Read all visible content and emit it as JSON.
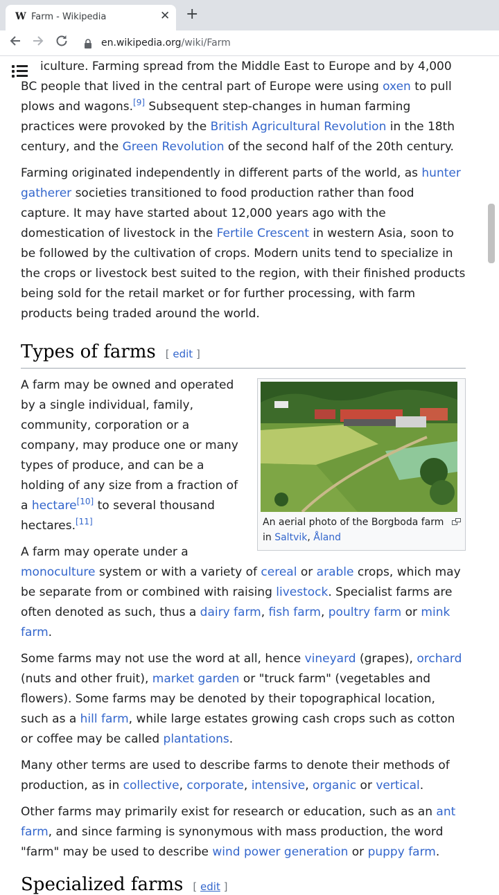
{
  "browser": {
    "tab_logo": "W",
    "tab_title": "Farm - Wikipedia",
    "tab_close": "✕",
    "new_tab": "+",
    "url_host": "en.wikipedia.org",
    "url_path": "/wiki/Farm"
  },
  "intro": {
    "p1": {
      "t1": "iculture. Farming spread from the Middle East to Europe and by 4,000 BC people that lived in the central part of Europe were using ",
      "l1": "oxen",
      "t2": " to pull plows and wagons.",
      "ref1": "[9]",
      "t3": " Subsequent step-changes in human farming practices were provoked by the ",
      "l2": "British Agricultural Revolution",
      "t4": " in the 18th century, and the ",
      "l3": "Green Revolution",
      "t5": " of the second half of the 20th century."
    },
    "p2": {
      "t1": "Farming originated independently in different parts of the world, as ",
      "l1": "hunter gatherer",
      "t2": " societies transitioned to food production rather than food capture. It may have started about 12,000 years ago with the domestication of livestock in the ",
      "l2": "Fertile Crescent",
      "t3": " in western Asia, soon to be followed by the cultivation of crops. Modern units tend to specialize in the crops or livestock best suited to the region, with their finished products being sold for the retail market or for further processing, with farm products being traded around the world."
    }
  },
  "section_types": {
    "heading": "Types of farms",
    "edit_open": "[ ",
    "edit_label": "edit",
    "edit_close": " ]",
    "figure": {
      "caption_text": "An aerial photo of the Borgboda farm in ",
      "caption_link1": "Saltvik",
      "caption_sep": ", ",
      "caption_link2": "Åland"
    },
    "p1": {
      "t1": "A farm may be owned and operated by a single individual, family, community, corporation or a company, may produce one or many types of produce, and can be a holding of any size from a fraction of a ",
      "l1": "hectare",
      "ref1": "[10]",
      "t2": " to several thousand hectares.",
      "ref2": "[11]"
    },
    "p2": {
      "t1": "A farm may operate under a ",
      "l1": "monoculture",
      "t2": " system or with a variety of ",
      "l2": "cereal",
      "t3": " or ",
      "l3": "arable",
      "t4": " crops, which may be separate from or combined with raising ",
      "l4": "livestock",
      "t5": ". Specialist farms are often denoted as such, thus a ",
      "l5": "dairy farm",
      "s1": ", ",
      "l6": "fish farm",
      "s2": ", ",
      "l7": "poultry farm",
      "t6": " or ",
      "l8": "mink farm",
      "t7": "."
    },
    "p3": {
      "t1": "Some farms may not use the word at all, hence ",
      "l1": "vineyard",
      "t2": " (grapes), ",
      "l2": "orchard",
      "t3": " (nuts and other fruit), ",
      "l3": "market garden",
      "t4": " or \"truck farm\" (vegetables and flowers). Some farms may be denoted by their topographical location, such as a ",
      "l4": "hill farm",
      "t5": ", while large estates growing cash crops such as cotton or coffee may be called ",
      "l5": "plantations",
      "t6": "."
    },
    "p4": {
      "t1": "Many other terms are used to describe farms to denote their methods of production, as in ",
      "l1": "collective",
      "s1": ", ",
      "l2": "corporate",
      "s2": ", ",
      "l3": "intensive",
      "s3": ", ",
      "l4": "organic",
      "t2": " or ",
      "l5": "vertical",
      "t3": "."
    },
    "p5": {
      "t1": "Other farms may primarily exist for research or education, such as an ",
      "l1": "ant farm",
      "t2": ", and since farming is synonymous with mass production, the word \"farm\" may be used to describe ",
      "l2": "wind power generation",
      "t3": " or ",
      "l3": "puppy farm",
      "t4": "."
    }
  },
  "next_section": {
    "heading": "Specialized farms",
    "edit_label": "edit"
  },
  "icons": [
    "back-arrow-icon",
    "forward-arrow-icon",
    "reload-icon",
    "lock-icon",
    "table-of-contents-icon",
    "magnify-icon"
  ]
}
